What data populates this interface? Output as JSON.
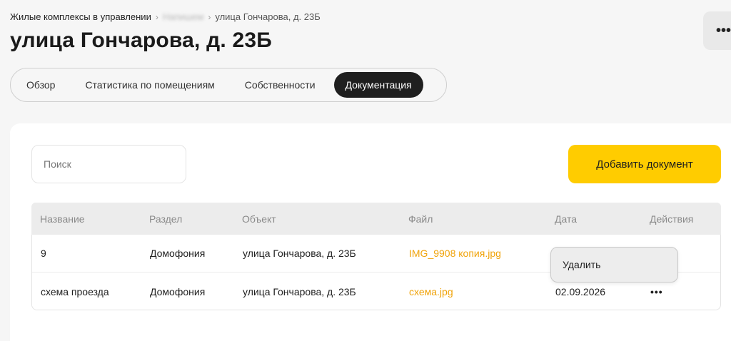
{
  "breadcrumb": {
    "root": "Жилые комплексы в управлении",
    "middle": "Напишем",
    "current": "улица Гончарова, д. 23Б"
  },
  "page_title": "улица Гончарова, д. 23Б",
  "header_more_label": "•••",
  "tabs": [
    {
      "label": "Обзор",
      "active": false
    },
    {
      "label": "Статистика по помещениям",
      "active": false
    },
    {
      "label": "Собственности",
      "active": false
    },
    {
      "label": "Документация",
      "active": true
    }
  ],
  "search": {
    "placeholder": "Поиск",
    "value": ""
  },
  "add_button_label": "Добавить документ",
  "table": {
    "headers": [
      "Название",
      "Раздел",
      "Объект",
      "Файл",
      "Дата",
      "Действия"
    ],
    "rows": [
      {
        "name": "9",
        "section": "Домофония",
        "object": "улица Гончарова, д. 23Б",
        "file": "IMG_9908 копия.jpg",
        "date": "",
        "actions": ""
      },
      {
        "name": "схема проезда",
        "section": "Домофония",
        "object": "улица Гончарова, д. 23Б",
        "file": "схема.jpg",
        "date": "02.09.2026",
        "actions": "•••"
      }
    ]
  },
  "dropdown": {
    "items": [
      "Удалить"
    ]
  },
  "colors": {
    "accent": "#ffcc00",
    "link": "#f0a30a",
    "active_tab": "#1f1f1f"
  }
}
